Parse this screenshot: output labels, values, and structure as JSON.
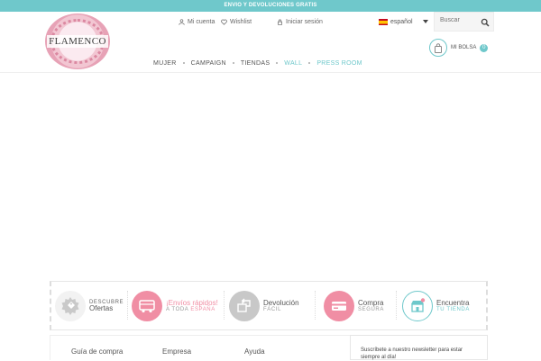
{
  "promo_bar": {
    "text": "ENVIO Y DEVOLUCIONES GRATIS"
  },
  "header": {
    "logo_text": "FLAMENCO",
    "account_label": "Mi cuenta",
    "wishlist_label": "Wishlist",
    "login_label": "Iniciar sesión",
    "language_label": "español",
    "search_placeholder": "Buscar",
    "bag_label": "MI BOLSA",
    "bag_count": "0"
  },
  "nav": {
    "items": [
      {
        "label": "MUJER"
      },
      {
        "label": "CAMPAIGN"
      },
      {
        "label": "TIENDAS"
      },
      {
        "label": "WALL"
      },
      {
        "label": "PRESS ROOM"
      }
    ]
  },
  "benefits": [
    {
      "line1": "DESCUBRE",
      "line2": "Ofertas",
      "icon": "discount-tag-icon",
      "color": "#cfcfcf"
    },
    {
      "line1": "¡Envíos rápidos!",
      "line2a": "A TODA",
      "line2b": "ESPAÑA",
      "icon": "delivery-truck-icon",
      "color": "#f08ea4"
    },
    {
      "line1": "Devolución",
      "line2": "FÁCIL",
      "icon": "return-box-icon",
      "color": "#c8c8c8"
    },
    {
      "line1": "Compra",
      "line2": "SEGURA",
      "icon": "credit-card-icon",
      "color": "#f08ea4"
    },
    {
      "line1": "Encuentra",
      "line2": "TU TIENDA",
      "icon": "store-location-icon",
      "color": "#6fc8cb"
    }
  ],
  "footer": {
    "col1": "Guía de compra",
    "col2": "Empresa",
    "col3": "Ayuda",
    "newsletter_text": "Suscríbete a nuestro newsletter para estar siempre al día!"
  },
  "colors": {
    "accent": "#6fc8cb",
    "pink": "#f08ea4"
  }
}
